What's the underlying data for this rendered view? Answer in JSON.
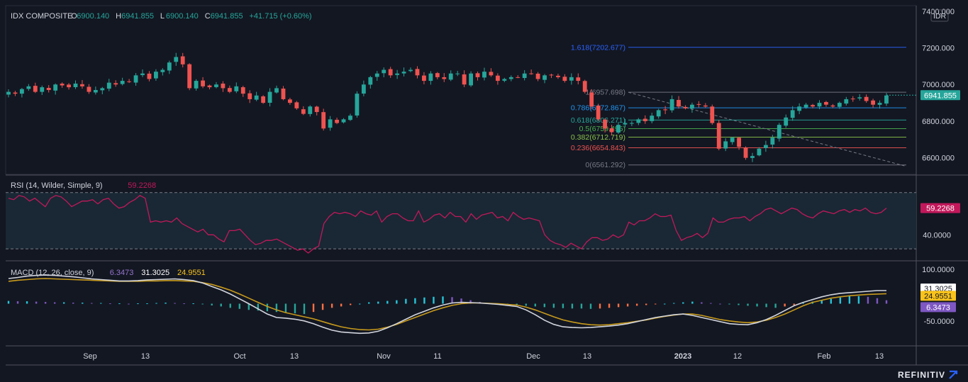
{
  "header": {
    "symbol": "IDX COMPOSITE",
    "open_label": "O",
    "open": "6900.140",
    "high_label": "H",
    "high": "6941.855",
    "low_label": "L",
    "low": "6900.140",
    "close_label": "C",
    "close": "6941.855",
    "change": "+41.715 (+0.60%)"
  },
  "currency": "IDR",
  "brand": "REFINITIV",
  "colors": {
    "up": "#26a69a",
    "down": "#ef5350",
    "rsi": "#c2185b",
    "macd": "#d1d4dc",
    "signal": "#c79a1b",
    "fib_ext": "#2962ff"
  },
  "chart_data": [
    {
      "type": "candlestick",
      "title": "IDX COMPOSITE",
      "x_ticks": [
        "Sep",
        "13",
        "Oct",
        "13",
        "Nov",
        "11",
        "Dec",
        "13",
        "2023",
        "12",
        "Feb",
        "13"
      ],
      "y_ticks": [
        7400,
        7200,
        7000,
        6800,
        6600
      ],
      "y_tick_labels": [
        "7400.000",
        "7200.000",
        "7000.000",
        "6800.000",
        "6600.000"
      ],
      "ylim": [
        6510,
        7430
      ],
      "last_price": 6941.855,
      "last_price_label": "6941.855",
      "close_series": [
        6960,
        6950,
        6975,
        6990,
        6960,
        6985,
        6970,
        7000,
        6995,
        6985,
        7005,
        6990,
        6960,
        6970,
        6980,
        7010,
        7000,
        7020,
        7015,
        7050,
        7060,
        7030,
        7070,
        7080,
        7120,
        7150,
        7110,
        6980,
        7020,
        6990,
        6985,
        7000,
        6980,
        6960,
        6990,
        6950,
        6920,
        6940,
        6900,
        6960,
        6980,
        6920,
        6900,
        6870,
        6840,
        6880,
        6850,
        6760,
        6810,
        6790,
        6810,
        6830,
        6950,
        7000,
        7040,
        7060,
        7080,
        7050,
        7060,
        7070,
        7080,
        7050,
        7020,
        7060,
        7040,
        7030,
        7060,
        7060,
        7000,
        7060,
        7040,
        7070,
        7050,
        7020,
        7030,
        7040,
        7040,
        7060,
        7060,
        7030,
        7050,
        7050,
        7040,
        7020,
        7040,
        7020,
        6960,
        6880,
        6810,
        6760,
        6740,
        6780,
        6790,
        6790,
        6810,
        6800,
        6830,
        6860,
        6860,
        6920,
        6880,
        6870,
        6890,
        6890,
        6880,
        6790,
        6650,
        6690,
        6710,
        6660,
        6600,
        6610,
        6650,
        6670,
        6710,
        6780,
        6820,
        6860,
        6880,
        6890,
        6880,
        6900,
        6890,
        6880,
        6900,
        6920,
        6920,
        6930,
        6910,
        6890,
        6900,
        6940
      ],
      "fib_levels": [
        {
          "label": "1.618(7202.677)",
          "value": 7202.677,
          "color": "#2962ff"
        },
        {
          "label": "1(6957.698)",
          "value": 6957.698,
          "color": "#787b86"
        },
        {
          "label": "0.786(6872.867)",
          "value": 6872.867,
          "color": "#2196f3"
        },
        {
          "label": "0.618(6806.271)",
          "value": 6806.271,
          "color": "#26a69a"
        },
        {
          "label": "0.5(6759.495)",
          "value": 6759.495,
          "color": "#4caf50"
        },
        {
          "label": "0.382(6712.719)",
          "value": 6712.719,
          "color": "#8bc34a"
        },
        {
          "label": "0.236(6654.843)",
          "value": 6654.843,
          "color": "#ef5350"
        },
        {
          "label": "0(6561.292)",
          "value": 6561.292,
          "color": "#787b86"
        }
      ]
    },
    {
      "type": "line",
      "title": "RSI (14, Wilder, Simple, 9)",
      "last_value": "59.2268",
      "y_ticks": [
        40
      ],
      "y_tick_labels": [
        "40.0000"
      ],
      "bands": [
        70,
        30
      ],
      "ylim": [
        22,
        82
      ],
      "values": [
        66,
        65,
        68,
        67,
        64,
        66,
        63,
        60,
        66,
        68,
        67,
        64,
        60,
        62,
        64,
        64,
        65,
        62,
        65,
        66,
        62,
        59,
        60,
        63,
        65,
        68,
        66,
        49,
        50,
        49,
        50,
        49,
        52,
        48,
        46,
        44,
        42,
        44,
        40,
        40,
        37,
        35,
        43,
        43,
        44,
        40,
        36,
        33,
        34,
        36,
        36,
        37,
        35,
        33,
        31,
        29,
        30,
        27,
        30,
        32,
        48,
        53,
        56,
        55,
        56,
        55,
        53,
        57,
        55,
        54,
        57,
        49,
        53,
        55,
        55,
        52,
        50,
        50,
        57,
        49,
        51,
        54,
        55,
        52,
        56,
        53,
        53,
        49,
        55,
        51,
        54,
        55,
        56,
        52,
        53,
        50,
        56,
        53,
        51,
        52,
        51,
        50,
        40,
        36,
        34,
        33,
        31,
        34,
        32,
        30,
        35,
        38,
        38,
        36,
        37,
        40,
        38,
        40,
        49,
        47,
        50,
        50,
        52,
        55,
        53,
        53,
        54,
        43,
        36,
        38,
        39,
        41,
        38,
        41,
        52,
        49,
        49,
        51,
        52,
        52,
        53,
        50,
        53,
        55,
        58,
        59,
        57,
        55,
        57,
        59,
        58,
        55,
        53,
        52,
        55,
        57,
        56,
        55,
        57,
        58,
        56,
        58,
        57,
        59,
        56,
        55,
        56,
        59
      ]
    },
    {
      "type": "line",
      "title": "MACD (12, 26, close, 9)",
      "histogram_label": "6.3473",
      "macd_label": "31.3025",
      "signal_label": "24.9551",
      "y_ticks": [
        100,
        -50
      ],
      "y_tick_labels": [
        "100.0000",
        "-50.0000"
      ],
      "ylim": [
        -110,
        110
      ],
      "macd": [
        73,
        76,
        80,
        82,
        83,
        82,
        80,
        78,
        75,
        72,
        70,
        68,
        66,
        66,
        67,
        69,
        70,
        71,
        72,
        70,
        67,
        60,
        50,
        40,
        28,
        14,
        0,
        -15,
        -30,
        -40,
        -42,
        -45,
        -50,
        -58,
        -68,
        -77,
        -82,
        -84,
        -86,
        -85,
        -80,
        -70,
        -58,
        -45,
        -32,
        -22,
        -12,
        -4,
        2,
        4,
        3,
        2,
        0,
        -2,
        -5,
        -8,
        -18,
        -32,
        -48,
        -60,
        -67,
        -69,
        -70,
        -69,
        -67,
        -65,
        -62,
        -58,
        -52,
        -46,
        -40,
        -36,
        -32,
        -30,
        -34,
        -40,
        -46,
        -52,
        -58,
        -60,
        -61,
        -55,
        -46,
        -34,
        -20,
        -6,
        4,
        12,
        20,
        26,
        30,
        32,
        34,
        36,
        38,
        38
      ],
      "signal": [
        65,
        68,
        70,
        72,
        73,
        72,
        71,
        70,
        69,
        68,
        67,
        66,
        65,
        65,
        65,
        66,
        66,
        67,
        67,
        66,
        65,
        61,
        56,
        48,
        39,
        28,
        16,
        4,
        -8,
        -18,
        -26,
        -32,
        -38,
        -44,
        -52,
        -60,
        -67,
        -72,
        -75,
        -76,
        -74,
        -68,
        -60,
        -50,
        -40,
        -30,
        -20,
        -12,
        -5,
        0,
        2,
        2,
        1,
        0,
        -2,
        -4,
        -10,
        -18,
        -28,
        -38,
        -47,
        -53,
        -58,
        -61,
        -62,
        -61,
        -58,
        -55,
        -51,
        -47,
        -42,
        -37,
        -33,
        -30,
        -30,
        -34,
        -40,
        -46,
        -50,
        -53,
        -55,
        -53,
        -48,
        -40,
        -30,
        -18,
        -6,
        4,
        10,
        16,
        20,
        23,
        25,
        27,
        28,
        29
      ],
      "histogram": [
        8,
        7,
        7,
        6,
        5,
        4,
        4,
        3,
        3,
        2,
        2,
        1,
        1,
        0,
        1,
        1,
        2,
        3,
        2,
        1,
        1,
        -2,
        -5,
        -8,
        -12,
        -15,
        -18,
        -20,
        -22,
        -24,
        -26,
        -28,
        -30,
        -24,
        -18,
        -12,
        -8,
        -4,
        0,
        4,
        6,
        8,
        10,
        14,
        16,
        18,
        20,
        21,
        19,
        15,
        10,
        5,
        2,
        -1,
        -3,
        -4,
        -6,
        -8,
        -10,
        -12,
        -13,
        -14,
        -14,
        -15,
        -14,
        -12,
        -10,
        -8,
        -6,
        -4,
        -2,
        0,
        2,
        4,
        6,
        4,
        2,
        0,
        -2,
        -4,
        -6,
        -8,
        -10,
        -12,
        -8,
        -4,
        2,
        6,
        10,
        14,
        18,
        22,
        22,
        20,
        16,
        10
      ]
    }
  ]
}
